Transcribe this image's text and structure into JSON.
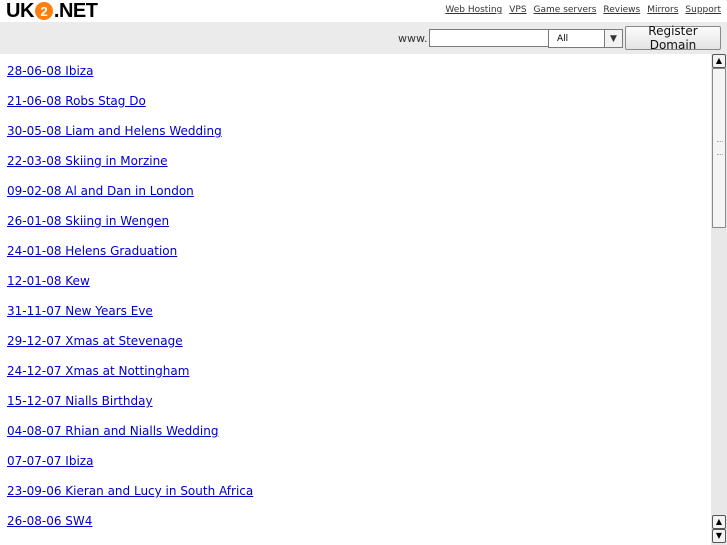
{
  "site": {
    "logo_left": "UK",
    "logo_num": "2",
    "logo_right": ".NET"
  },
  "top_links": [
    "Web Hosting",
    "VPS",
    "Game servers",
    "Reviews",
    "Mirrors",
    "Support"
  ],
  "search": {
    "prefix": "www.",
    "input_value": "",
    "tld_selected": "All",
    "register_label": "Register Domain"
  },
  "entries": [
    "28-06-08 Ibiza",
    "21-06-08 Robs Stag Do",
    "30-05-08 Liam and Helens Wedding",
    "22-03-08 Skiing in Morzine",
    "09-02-08 Al and Dan in London",
    "26-01-08 Skiing in Wengen",
    "24-01-08 Helens Graduation",
    "12-01-08 Kew",
    "31-11-07 New Years Eve",
    "29-12-07 Xmas at Stevenage",
    "24-12-07 Xmas at Nottingham",
    "15-12-07 Nialls Birthday",
    "04-08-07 Rhian and Nialls Wedding",
    "07-07-07 Ibiza",
    "23-09-06 Kieran and Lucy in South Africa",
    "26-08-06 SW4"
  ],
  "icons": {
    "select_arrow": "triangle-down-icon",
    "scroll_up": "triangle-up-icon",
    "scroll_down": "triangle-down-icon"
  }
}
